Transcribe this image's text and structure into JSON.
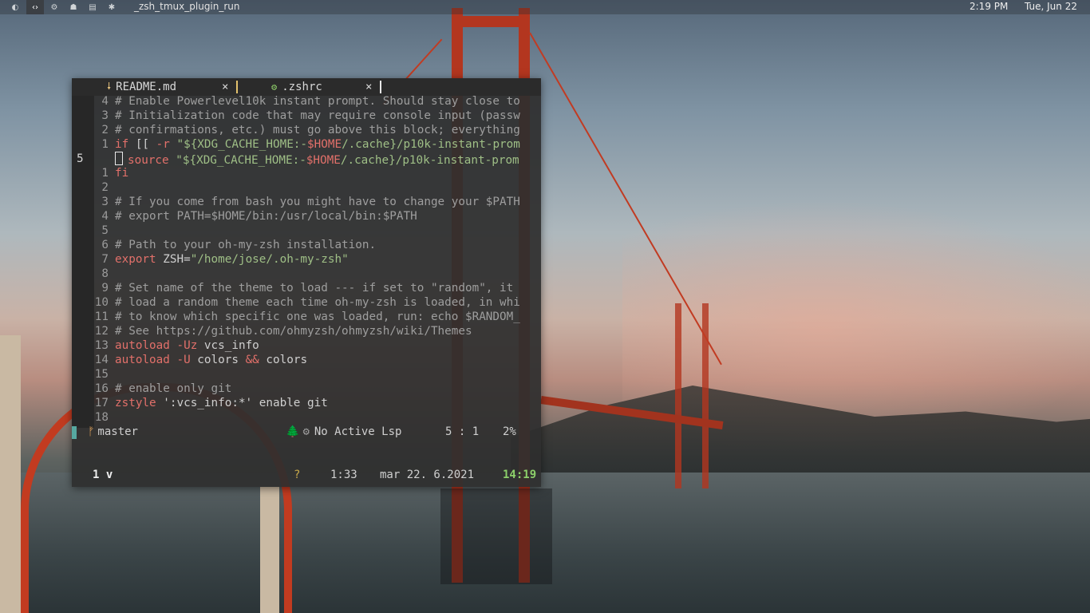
{
  "topbar": {
    "workspaces": [
      "◐",
      "‹›",
      "⚙",
      "☗",
      "▤",
      "✱"
    ],
    "window_title": "_zsh_tmux_plugin_run",
    "time": "2:19 PM",
    "date": "Tue, Jun 22"
  },
  "tabs": [
    {
      "icon": "🠗",
      "label": "README.md",
      "close": "×"
    },
    {
      "icon": "⚙",
      "label": ".zshrc",
      "close": "×"
    }
  ],
  "editor": {
    "lines": [
      {
        "n": "4",
        "text": "# Enable Powerlevel10k instant prompt. Should stay close to"
      },
      {
        "n": "3",
        "text": "# Initialization code that may require console input (passw"
      },
      {
        "n": "2",
        "text": "# confirmations, etc.) must go above this block; everything"
      },
      {
        "n": "1",
        "text": "if [[ -r \"${XDG_CACHE_HOME:-$HOME/.cache}/p10k-instant-prom"
      },
      {
        "n": "5",
        "text": "  source \"${XDG_CACHE_HOME:-$HOME/.cache}/p10k-instant-prom"
      },
      {
        "n": "1",
        "text": "fi"
      },
      {
        "n": "2",
        "text": ""
      },
      {
        "n": "3",
        "text": "# If you come from bash you might have to change your $PATH"
      },
      {
        "n": "4",
        "text": "# export PATH=$HOME/bin:/usr/local/bin:$PATH"
      },
      {
        "n": "5",
        "text": ""
      },
      {
        "n": "6",
        "text": "# Path to your oh-my-zsh installation."
      },
      {
        "n": "7",
        "text": "export ZSH=\"/home/jose/.oh-my-zsh\""
      },
      {
        "n": "8",
        "text": ""
      },
      {
        "n": "9",
        "text": "# Set name of the theme to load --- if set to \"random\", it"
      },
      {
        "n": "10",
        "text": "# load a random theme each time oh-my-zsh is loaded, in whi"
      },
      {
        "n": "11",
        "text": "# to know which specific one was loaded, run: echo $RANDOM_"
      },
      {
        "n": "12",
        "text": "# See https://github.com/ohmyzsh/ohmyzsh/wiki/Themes"
      },
      {
        "n": "13",
        "text": "autoload -Uz vcs_info"
      },
      {
        "n": "14",
        "text": "autoload -U colors && colors"
      },
      {
        "n": "15",
        "text": ""
      },
      {
        "n": "16",
        "text": "# enable only git"
      },
      {
        "n": "17",
        "text": "zstyle ':vcs_info:*' enable git"
      },
      {
        "n": "18",
        "text": ""
      }
    ]
  },
  "statusline": {
    "branch_icon": "ᚠ",
    "branch": "master",
    "tree_icon": "🌲",
    "gears_icon": "⚙",
    "lsp": "No Active Lsp",
    "position": "5 : 1",
    "percent": "2%"
  },
  "tmux": {
    "window": "1 v",
    "indicator": "?",
    "load": "1:33",
    "date": "mar 22. 6.2021",
    "time": "14:19"
  }
}
